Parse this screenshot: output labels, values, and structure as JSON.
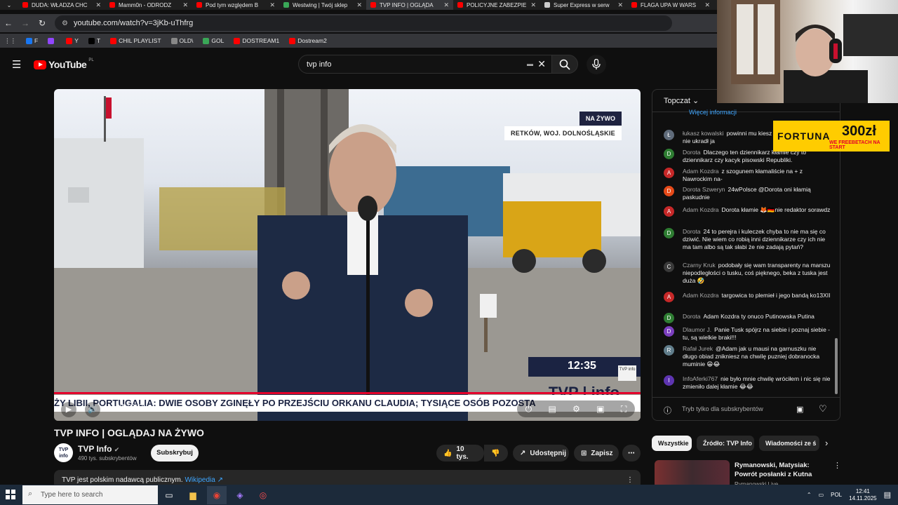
{
  "browser": {
    "tabs": [
      {
        "title": "DUDA: WŁADZA CHC",
        "color": "#ff0000",
        "active": false
      },
      {
        "title": "Mamm0n - ODRODZ",
        "color": "#ff0000",
        "active": false
      },
      {
        "title": "Pod tym względem B",
        "color": "#ff0000",
        "active": false
      },
      {
        "title": "Westwing | Twój sklep",
        "color": "#3aa757",
        "active": false
      },
      {
        "title": "TVP INFO | OGLĄDA",
        "color": "#ff0000",
        "active": true
      },
      {
        "title": "POLICYJNE ZABEZPIE",
        "color": "#ff0000",
        "active": false
      },
      {
        "title": "Super Express w serw",
        "color": "#cccccc",
        "active": false
      },
      {
        "title": "FLAGA UPA W WARS",
        "color": "#ff0000",
        "active": false
      }
    ],
    "url": "youtube.com/watch?v=3jKb-uThfrg",
    "bookmarks": [
      {
        "label": "F",
        "color": "#1877f2"
      },
      {
        "label": "",
        "color": "#9146ff"
      },
      {
        "label": "Y",
        "color": "#ff0000"
      },
      {
        "label": "T",
        "color": "#000000"
      },
      {
        "label": "CHIL PLAYLIST",
        "color": "#ff0000"
      },
      {
        "label": "OLD\\",
        "color": "#888888"
      },
      {
        "label": "GOL",
        "color": "#3aa757"
      },
      {
        "label": "DOSTREAM1",
        "color": "#ff0000"
      },
      {
        "label": "Dostream2",
        "color": "#ff0000"
      }
    ]
  },
  "youtube": {
    "logo_text": "YouTube",
    "region": "PL",
    "search_query": "tvp info"
  },
  "player": {
    "live_label": "NA ŻYWO",
    "location": "RETKÓW, WOJ. DOLNOŚLĄSKIE",
    "clock": "12:35",
    "channel_logo": "TVP info",
    "channel_big": "TVP | info",
    "ticker": "ŻY LIBII, PORTUGALIA: DWIE OSOBY ZGINĘŁY PO PRZEJŚCIU ORKANU CLAUDIA; TYSIĄCE OSÓB POZOSTA",
    "ctrl_live": "NA ŻYWO"
  },
  "video": {
    "title": "TVP INFO | OGLĄDAJ NA ŻYWO",
    "channel": "TVP Info",
    "avatar_text": "TVP info",
    "subs": "490 tys. subskrybentów",
    "subscribe": "Subskrybuj",
    "likes": "10 tys.",
    "share": "Udostępnij",
    "save": "Zapisz",
    "description": "TVP jest polskim nadawcą publicznym.",
    "wiki": "Wikipedia ↗"
  },
  "chat": {
    "header": "Topczat",
    "info_link": "Więcej informacji",
    "messages": [
      {
        "author": "łukasz kowalski",
        "text": "powinni mu kiesz posprawdzać czy nic nie ukradł ja",
        "initial": "Ł",
        "color": "#5f6b7a"
      },
      {
        "author": "Dorota",
        "text": "Dlaczego ten dziennikarz kłamie czy to dziennikarz czy kacyk pisowski Republiki.",
        "initial": "D",
        "color": "#2e7d32"
      },
      {
        "author": "Adam Kozdra",
        "text": "z szogunem kłamaliście na + z Nawrockim na-",
        "initial": "A",
        "color": "#c62828"
      },
      {
        "author": "Dorota Szweryn",
        "text": "24wPolsce @Dorota oni kłamią paskudnie",
        "initial": "D",
        "color": "#e64a19"
      },
      {
        "author": "Adam Kozdra",
        "text": "Dorota kłamie 🦊🇩🇪nie redaktor sorawdz",
        "initial": "A",
        "color": "#c62828"
      },
      {
        "author": "Dorota",
        "text": "24 to perejra i kuleczek chyba to nie ma się co dziwić. Nie wiem co robią inni dziennikarze czy ich nie ma tam albo są tak słabi że nie zadają pytań?",
        "initial": "D",
        "color": "#2e7d32"
      },
      {
        "author": "Czarny Kruk",
        "text": "podobały się wam transparenty na marszu niepodległości o tusku, coś pięknego, beka z tuska jest duża 🤣",
        "initial": "C",
        "color": "#3a3a3a"
      },
      {
        "author": "Adam Kozdra",
        "text": "targowica to plemieł i jego bandą ko13XII",
        "initial": "A",
        "color": "#c62828"
      },
      {
        "author": "Dorota",
        "text": "Adam Kozdra ty onuco Putinowska Putina",
        "initial": "D",
        "color": "#2e7d32"
      },
      {
        "author": "Dlaumor J.",
        "text": "Panie Tusk spójrz na siebie i poznaj siebie - tu, są wielkie braki!!!",
        "initial": "D",
        "color": "#7b3fbf"
      },
      {
        "author": "Rafał Jurek",
        "text": "@Adam jak u mausi na garnuszku nie długo obiad znikniesz na chwilę puzniej dobranocka muminie 😁😂",
        "initial": "R",
        "color": "#607d8b"
      },
      {
        "author": "InfoAferki767",
        "text": "nie było mnie chwilę wróciłem i nic się nie zmieniło dalej kłamie 😂😂",
        "initial": "I",
        "color": "#5e35b1"
      }
    ],
    "input_placeholder": "Tryb tylko dla subskrybentów"
  },
  "chips": [
    "Wszystkie",
    "Źródło: TVP Info",
    "Wiadomości ze ś"
  ],
  "related": {
    "title": "Rymanowski, Matysiak: Powrót posłanki z Kutna",
    "channel": "Rymanowski Live"
  },
  "overlay_ad": {
    "brand": "FORTUNA",
    "amount": "300zł",
    "tagline": "WE FREEBETACH NA START"
  },
  "taskbar": {
    "search_placeholder": "Type here to search",
    "lang": "POL",
    "time": "12:41",
    "date": "14.11.2025"
  }
}
